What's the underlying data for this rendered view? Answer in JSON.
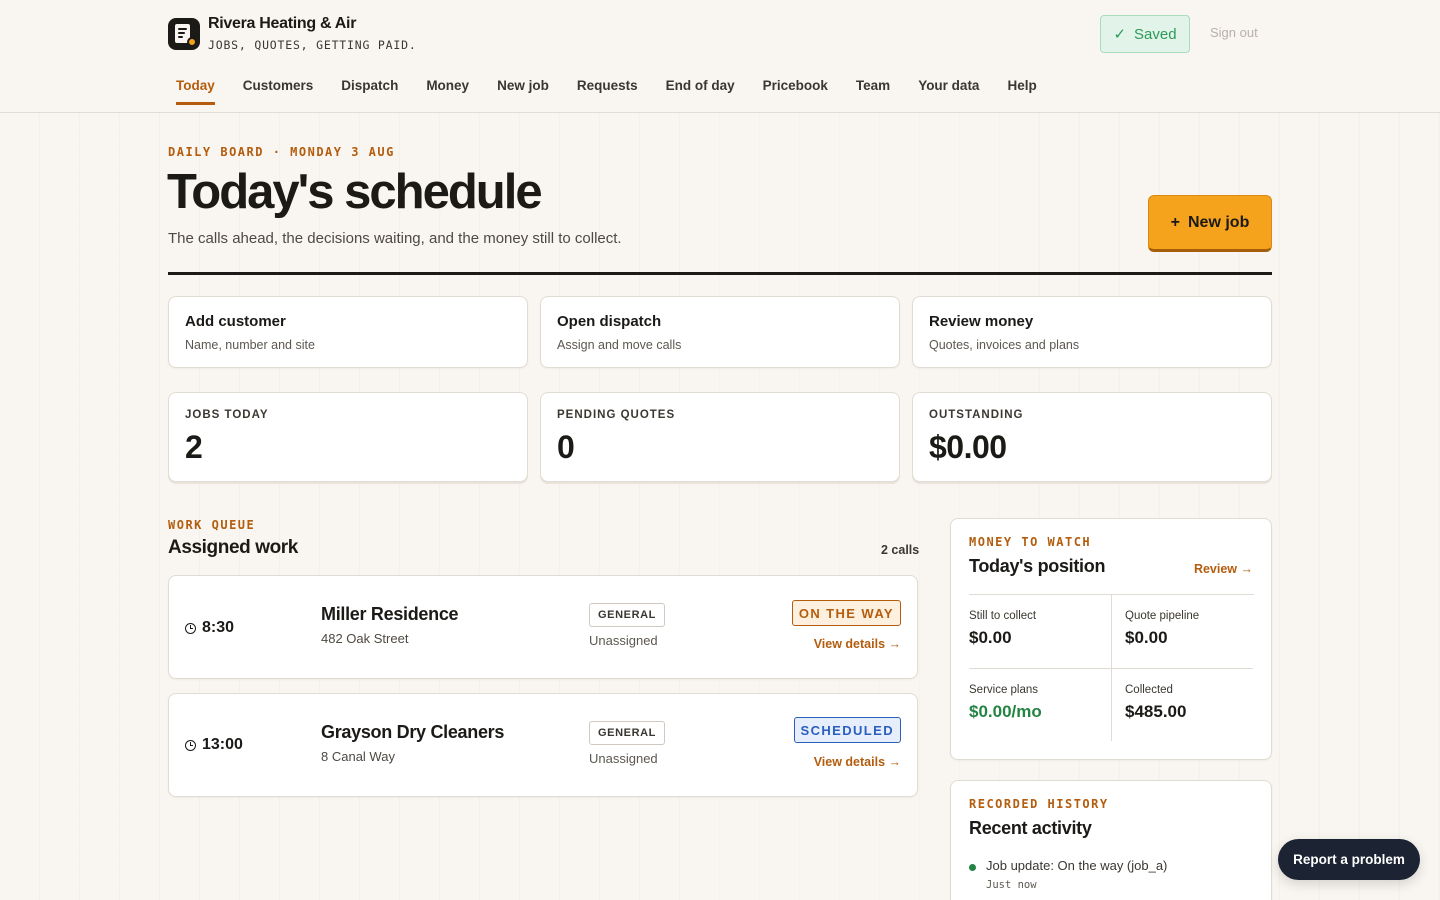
{
  "brand": {
    "name": "Rivera Heating & Air",
    "tagline": "JOBS, QUOTES, GETTING PAID."
  },
  "header": {
    "saved_label": "Saved",
    "sign_out": "Sign out"
  },
  "nav": {
    "items": [
      {
        "label": "Today",
        "active": true
      },
      {
        "label": "Customers"
      },
      {
        "label": "Dispatch"
      },
      {
        "label": "Money"
      },
      {
        "label": "New job"
      },
      {
        "label": "Requests"
      },
      {
        "label": "End of day"
      },
      {
        "label": "Pricebook"
      },
      {
        "label": "Team"
      },
      {
        "label": "Your data"
      },
      {
        "label": "Help"
      }
    ]
  },
  "page": {
    "kicker": "DAILY BOARD · MONDAY 3 AUG",
    "title": "Today's schedule",
    "subtitle": "The calls ahead, the decisions waiting, and the money still to collect.",
    "new_job_label": "New job"
  },
  "actions": [
    {
      "title": "Add customer",
      "subtitle": "Name, number and site"
    },
    {
      "title": "Open dispatch",
      "subtitle": "Assign and move calls"
    },
    {
      "title": "Review money",
      "subtitle": "Quotes, invoices and plans"
    }
  ],
  "stats": [
    {
      "label": "JOBS TODAY",
      "value": "2"
    },
    {
      "label": "PENDING QUOTES",
      "value": "0"
    },
    {
      "label": "OUTSTANDING",
      "value": "$0.00"
    }
  ],
  "work_queue": {
    "kicker": "WORK QUEUE",
    "title": "Assigned work",
    "count": "2 calls",
    "jobs": [
      {
        "time": "8:30",
        "name": "Miller Residence",
        "address": "482 Oak Street",
        "type": "GENERAL",
        "assignee": "Unassigned",
        "status": "ON THE WAY",
        "link": "View details →"
      },
      {
        "time": "13:00",
        "name": "Grayson Dry Cleaners",
        "address": "8 Canal Way",
        "type": "GENERAL",
        "assignee": "Unassigned",
        "status": "SCHEDULED",
        "link": "View details →"
      }
    ]
  },
  "money": {
    "kicker": "MONEY TO WATCH",
    "title": "Today's position",
    "review_link": "Review →",
    "cells": [
      {
        "label": "Still to collect",
        "value": "$0.00"
      },
      {
        "label": "Quote pipeline",
        "value": "$0.00"
      },
      {
        "label": "Service plans",
        "value": "$0.00/mo"
      },
      {
        "label": "Collected",
        "value": "$485.00"
      }
    ]
  },
  "history": {
    "kicker": "RECORDED HISTORY",
    "title": "Recent activity",
    "items": [
      {
        "text": "Job update: On the way (job_a)",
        "time": "Just now"
      }
    ]
  },
  "report_button": "Report a problem",
  "colors": {
    "accent": "#b45d0e",
    "primary_button": "#f5a21c",
    "success": "#248443",
    "scheduled": "#2b5fbd"
  }
}
